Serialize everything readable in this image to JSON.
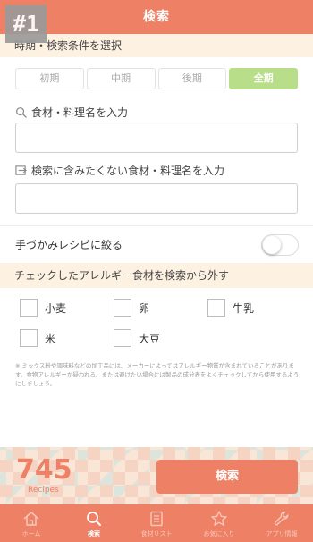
{
  "badge": "#1",
  "header": {
    "title": "検索"
  },
  "period_section": {
    "title": "時期・検索条件を選択",
    "options": [
      "初期",
      "中期",
      "後期",
      "全期"
    ],
    "selected": "全期"
  },
  "ingredient_search": {
    "label": "食材・料理名を入力",
    "value": "",
    "icon": "search-icon"
  },
  "exclude_search": {
    "label": "検索に含みたくない食材・料理名を入力",
    "value": "",
    "icon": "exclude-icon"
  },
  "finger_food": {
    "label": "手づかみレシピに絞る",
    "enabled": false
  },
  "allergy_section": {
    "title": "チェックしたアレルギー食材を検索から外す",
    "items": [
      "小麦",
      "卵",
      "牛乳",
      "米",
      "大豆"
    ]
  },
  "note": "※ ミックス粉や調味料などの加工品には、メーカーによってはアレルギー物質が含まれていることがあります。食物アレルギーが疑われる、または避けたい場合には製品の成分表をよくチェックしてから使用するようにしましょう。",
  "result": {
    "count": "745",
    "count_label": "Recipes",
    "button": "検索"
  },
  "colors": {
    "accent": "#ee8066",
    "selected_period": "#b9de8a",
    "section_bg": "#fdf1e2"
  },
  "tabbar": {
    "tabs": [
      {
        "label": "ホーム",
        "icon": "home-icon"
      },
      {
        "label": "検索",
        "icon": "search-icon",
        "active": true
      },
      {
        "label": "食材リスト",
        "icon": "list-icon"
      },
      {
        "label": "お気に入り",
        "icon": "star-icon"
      },
      {
        "label": "アプリ情報",
        "icon": "wrench-icon"
      }
    ]
  }
}
